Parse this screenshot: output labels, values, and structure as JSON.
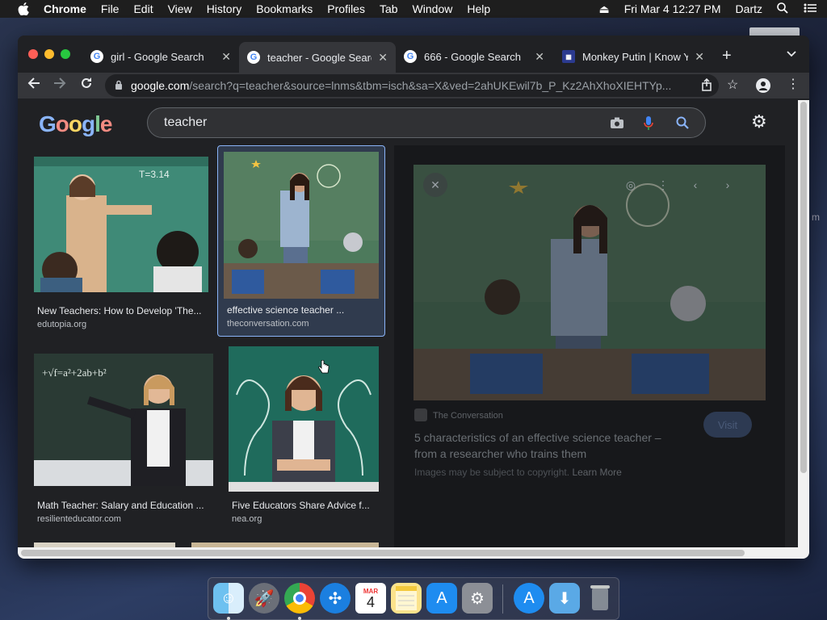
{
  "menubar": {
    "app": "Chrome",
    "items": [
      "File",
      "Edit",
      "View",
      "History",
      "Bookmarks",
      "Profiles",
      "Tab",
      "Window",
      "Help"
    ],
    "datetime": "Fri Mar 4  12:27 PM",
    "user": "Dartz"
  },
  "tabs": [
    {
      "title": "girl - Google Search"
    },
    {
      "title": "teacher - Google Search"
    },
    {
      "title": "666 - Google Search"
    },
    {
      "title": "Monkey Putin | Know Your Meme"
    }
  ],
  "address": {
    "host": "google.com",
    "path": "/search?q=teacher&source=lnms&tbm=isch&sa=X&ved=2ahUKEwil7b_P_Kz2AhXhoXIEHTYp..."
  },
  "search": {
    "query": "teacher",
    "logo": "Google"
  },
  "results": [
    {
      "title": "New Teachers: How to Develop 'The...",
      "source": "edutopia.org"
    },
    {
      "title": "effective science teacher ...",
      "source": "theconversation.com"
    },
    {
      "title": "Math Teacher: Salary and Education ...",
      "source": "resilienteducator.com"
    },
    {
      "title": "Five Educators Share Advice f...",
      "source": "nea.org"
    }
  ],
  "preview": {
    "site": "The Conversation",
    "title_line1": "5 characteristics of an effective science teacher –",
    "title_line2": "from a researcher who trains them",
    "copyright": "Images may be subject to copyright.",
    "learn_more": "Learn More",
    "visit": "Visit"
  },
  "side_label": "m",
  "dock": {
    "calendar_month": "MAR",
    "calendar_day": "4"
  },
  "colors": {
    "accent": "#8ab4f8",
    "page_bg": "#202124",
    "chrome_toolbar": "#35363a"
  }
}
